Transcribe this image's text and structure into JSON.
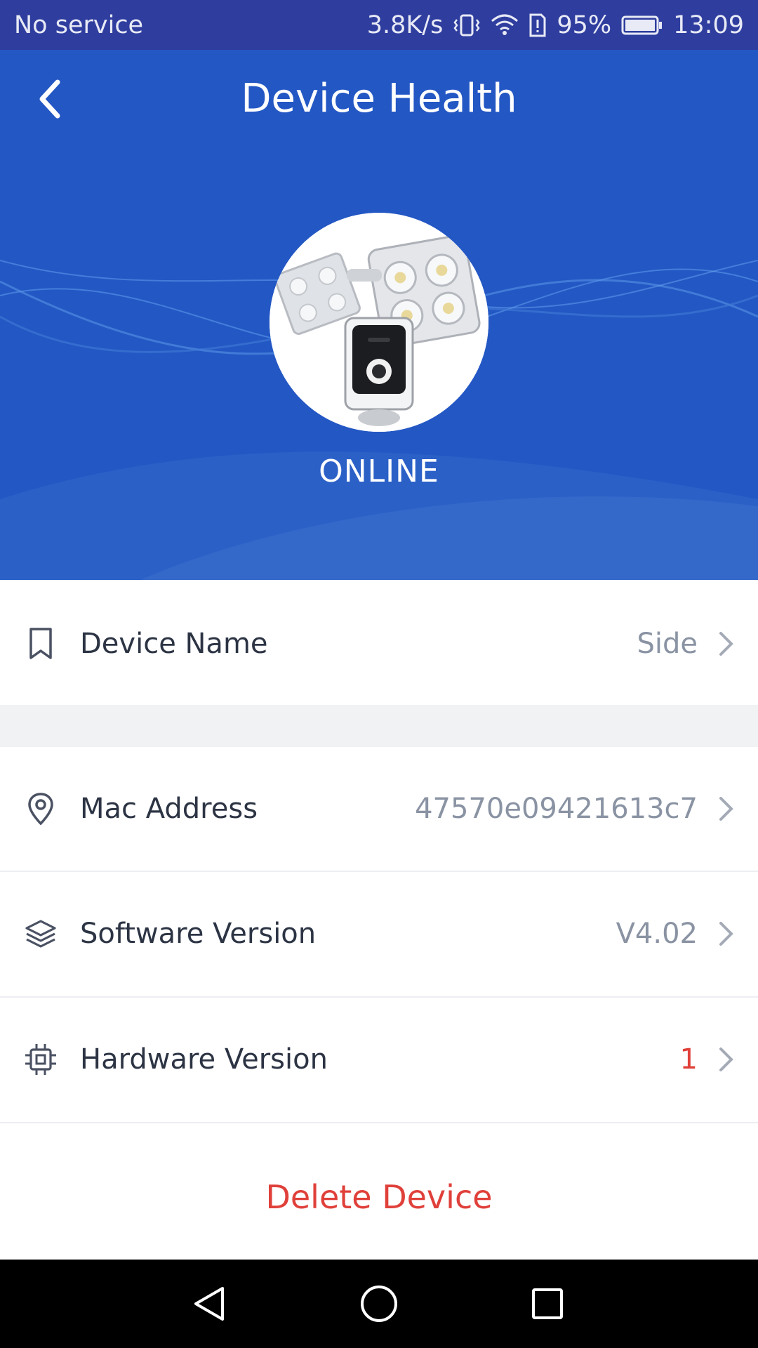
{
  "status_bar": {
    "carrier": "No service",
    "speed": "3.8K/s",
    "battery": "95%",
    "time": "13:09"
  },
  "header": {
    "title": "Device Health",
    "device_status": "ONLINE",
    "accent_color": "#2357c4"
  },
  "rows": {
    "device_name": {
      "label": "Device Name",
      "value": "Side"
    },
    "mac_address": {
      "label": "Mac Address",
      "value": "47570e09421613c7"
    },
    "software_version": {
      "label": "Software Version",
      "value": "V4.02"
    },
    "hardware_version": {
      "label": "Hardware Version",
      "value": "1"
    }
  },
  "actions": {
    "delete_label": "Delete Device"
  }
}
